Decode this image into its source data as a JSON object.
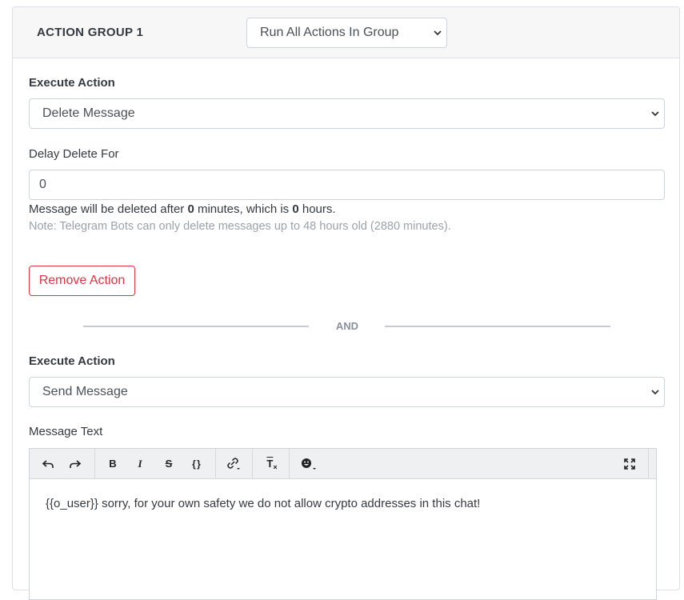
{
  "group": {
    "title": "ACTION GROUP 1",
    "mode_select": "Run All Actions In Group"
  },
  "action1": {
    "execute_label": "Execute Action",
    "execute_value": "Delete Message",
    "delay_label": "Delay Delete For",
    "delay_value": "0",
    "help_prefix": "Message will be deleted after ",
    "help_minutes": "0",
    "help_middle": " minutes, which is ",
    "help_hours": "0",
    "help_suffix": " hours.",
    "note": "Note: Telegram Bots can only delete messages up to 48 hours old (2880 minutes).",
    "remove_label": "Remove Action"
  },
  "divider": {
    "text": "AND"
  },
  "action2": {
    "execute_label": "Execute Action",
    "execute_value": "Send Message",
    "message_label": "Message Text",
    "message_content": "{{o_user}} sorry, for your own safety we do not allow crypto addresses in this chat!"
  },
  "toolbar": {
    "undo_icon": "undo-icon",
    "redo_icon": "redo-icon",
    "bold_glyph": "B",
    "italic_glyph": "I",
    "strike_glyph": "S",
    "code_glyph": "{ }",
    "clear_glyph": "T",
    "fullscreen_icon": "fullscreen-icon"
  },
  "colors": {
    "danger": "#dc3545",
    "muted": "#9aa3ab",
    "header_bg": "#f7f7f7"
  }
}
